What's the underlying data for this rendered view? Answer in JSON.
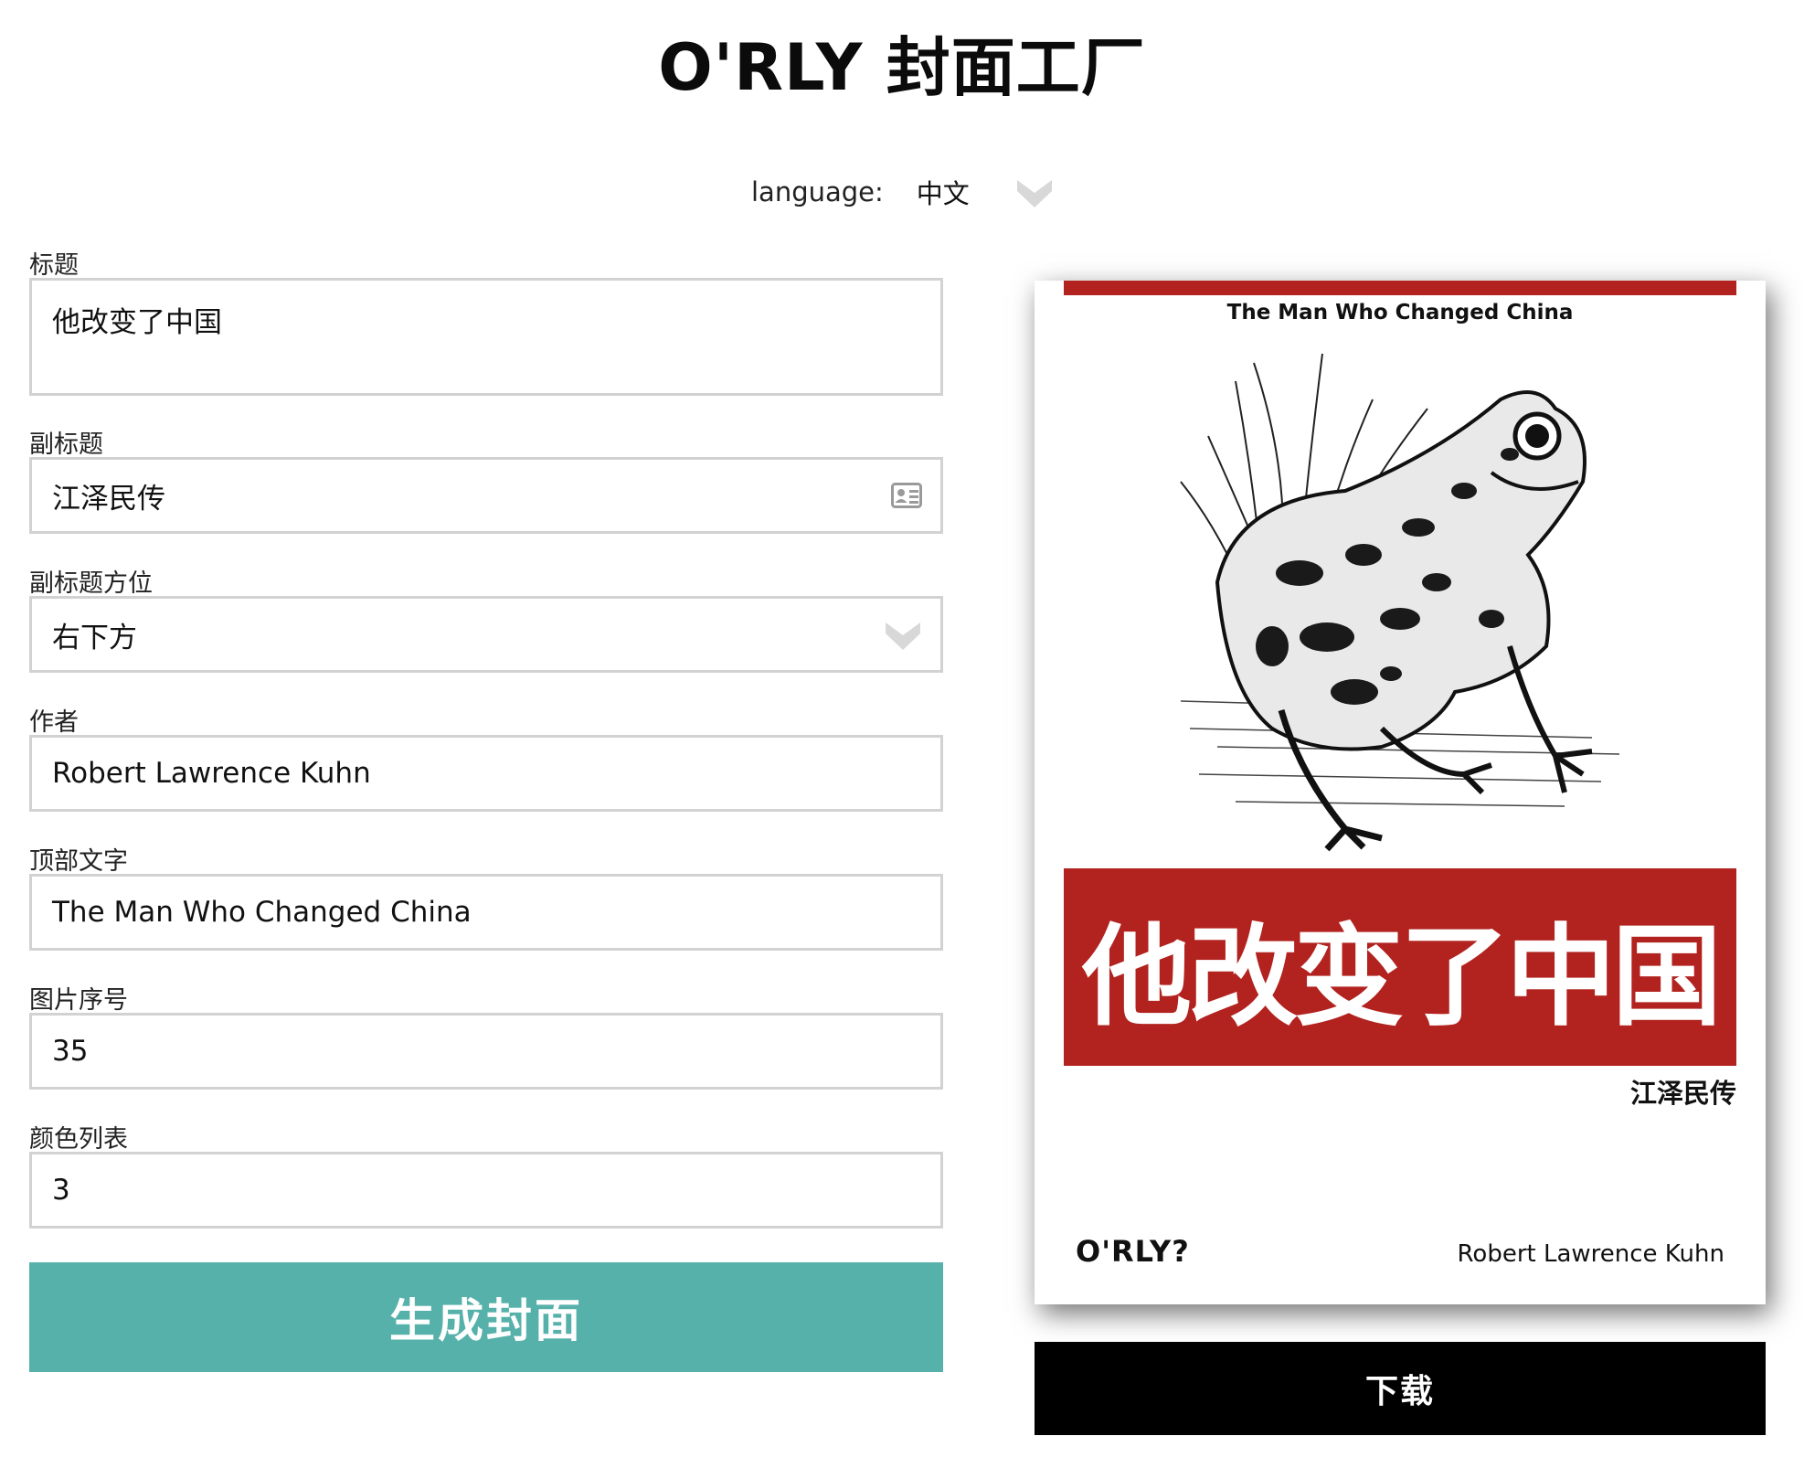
{
  "header": {
    "title": "O'RLY 封面工厂"
  },
  "language": {
    "label": "language:",
    "value": "中文",
    "icon": "chevron-down-icon"
  },
  "form": {
    "title": {
      "label": "标题",
      "value": "他改变了中国"
    },
    "subtitle": {
      "label": "副标题",
      "value": "江泽民传",
      "icon": "contact-card-icon"
    },
    "subtitle_position": {
      "label": "副标题方位",
      "value": "右下方",
      "icon": "chevron-down-icon"
    },
    "author": {
      "label": "作者",
      "value": "Robert Lawrence Kuhn"
    },
    "top_text": {
      "label": "顶部文字",
      "value": "The Man Who Changed China"
    },
    "image_index": {
      "label": "图片序号",
      "value": "35"
    },
    "color_list": {
      "label": "颜色列表",
      "value": "3"
    },
    "generate_label": "生成封面"
  },
  "cover": {
    "top_text": "The Man Who Changed China",
    "title": "他改变了中国",
    "subtitle": "江泽民传",
    "brand": "O'RLY?",
    "author": "Robert Lawrence Kuhn",
    "accent_color": "#b2221e",
    "animal": "frog-illustration"
  },
  "download_label": "下载",
  "colors": {
    "generate_button": "#56b1aa",
    "download_button": "#000000",
    "field_border": "#d2d2d2"
  }
}
